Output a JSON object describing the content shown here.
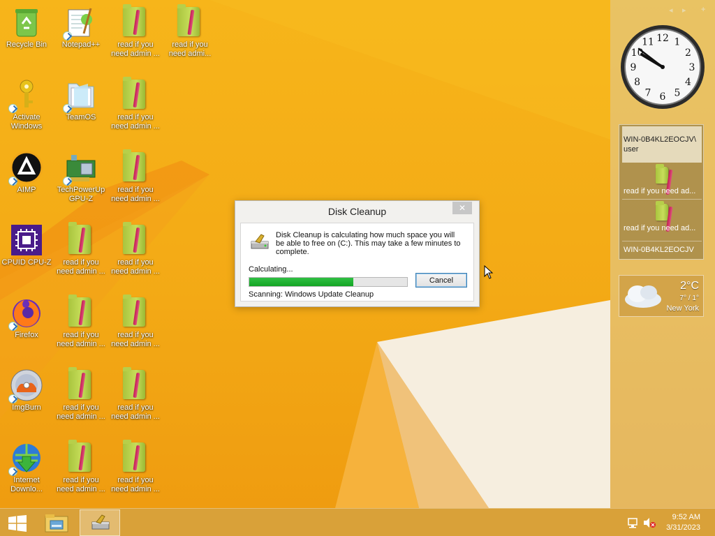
{
  "desktop": {
    "icons": [
      {
        "label": "Recycle Bin"
      },
      {
        "label": "Notepad++"
      },
      {
        "label": "read if you need admin ..."
      },
      {
        "label": "read if you need admi..."
      },
      {
        "label": "Activate Windows"
      },
      {
        "label": "TeamOS"
      },
      {
        "label": "read if you need admin ..."
      },
      {
        "label": "AIMP"
      },
      {
        "label": "TechPowerUp GPU-Z"
      },
      {
        "label": "read if you need admin ..."
      },
      {
        "label": "CPUID CPU-Z"
      },
      {
        "label": "read if you need admin ..."
      },
      {
        "label": "read if you need admin ..."
      },
      {
        "label": "Firefox"
      },
      {
        "label": "read if you need admin ..."
      },
      {
        "label": "read if you need admin ..."
      },
      {
        "label": "ImgBurn"
      },
      {
        "label": "read if you need admin ..."
      },
      {
        "label": "read if you need admin ..."
      },
      {
        "label": "Internet Downlo..."
      },
      {
        "label": "read if you need admin ..."
      },
      {
        "label": "read if you need admin ..."
      }
    ]
  },
  "sidebar": {
    "nav_prev": "◂",
    "nav_next": "▸",
    "add": "+",
    "clock": {
      "numerals": [
        "12",
        "1",
        "2",
        "3",
        "4",
        "5",
        "6",
        "7",
        "8",
        "9",
        "10",
        "11"
      ]
    },
    "feeds": {
      "items": [
        {
          "label": "WIN-0B4KL2EOCJV\\ user"
        },
        {
          "label": "read if you need ad..."
        },
        {
          "label": "read if you need ad..."
        },
        {
          "label": "WIN-0B4KL2EOCJV"
        }
      ]
    },
    "weather": {
      "temp": "2°C",
      "range": "7° / 1°",
      "city": "New York"
    }
  },
  "dialog": {
    "title": "Disk Cleanup",
    "close": "✕",
    "message": "Disk Cleanup is calculating how much space you will be able to free on  (C:). This may take a few minutes to complete.",
    "status": "Calculating...",
    "progress": 0.66,
    "scanning": "Scanning:  Windows Update Cleanup",
    "cancel": "Cancel"
  },
  "taskbar": {
    "time": "9:52 AM",
    "date": "3/31/2023"
  },
  "colors": {
    "wallpaper": "#f5b21a",
    "progress": "#1fb032",
    "accent": "#3c7fb1"
  }
}
